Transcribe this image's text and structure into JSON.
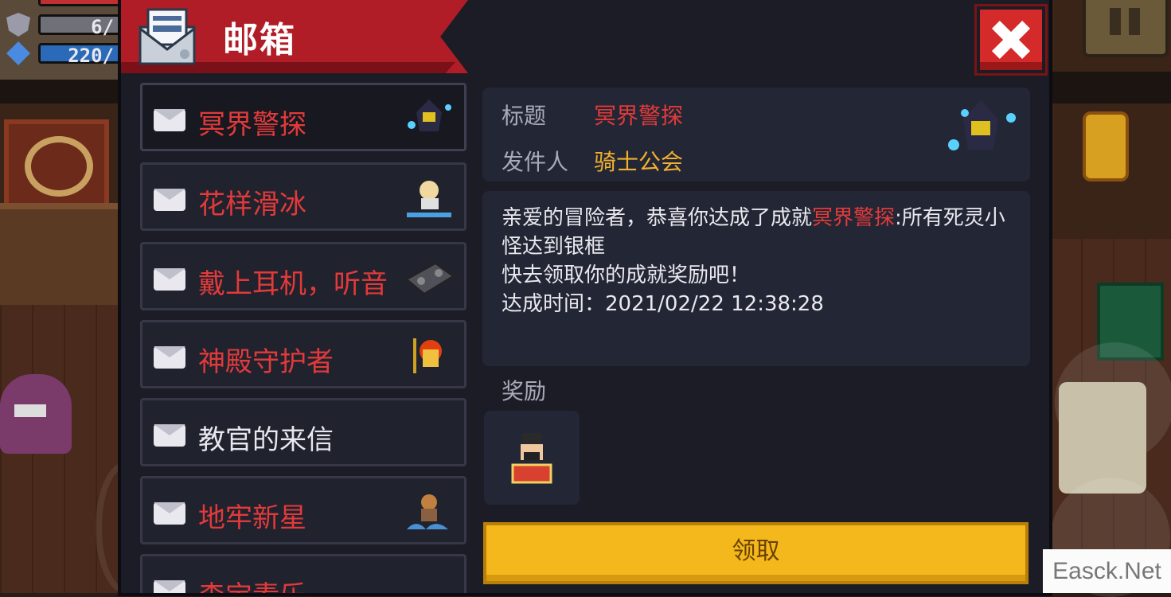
{
  "hud": {
    "armor": "6/",
    "energy": "220/"
  },
  "header": {
    "title": "邮箱"
  },
  "mail_list": [
    {
      "label": "冥界警探",
      "color": "red",
      "icon": "ghost-knight-icon",
      "selected": true
    },
    {
      "label": "花样滑冰",
      "color": "red",
      "icon": "skater-icon"
    },
    {
      "label": "戴上耳机，听音",
      "color": "red",
      "icon": "boombox-icon"
    },
    {
      "label": "神殿守护者",
      "color": "red",
      "icon": "temple-guardian-icon"
    },
    {
      "label": "教官的来信",
      "color": "white",
      "icon": ""
    },
    {
      "label": "地牢新星",
      "color": "red",
      "icon": "monkey-wave-icon"
    },
    {
      "label": "森宝素乐",
      "color": "red",
      "icon": ""
    }
  ],
  "detail": {
    "title_label": "标题",
    "title_value": "冥界警探",
    "sender_label": "发件人",
    "sender_value": "骑士公会",
    "body_prefix": "亲爱的冒险者，恭喜你达成了成就",
    "body_highlight": "冥界警探",
    "body_suffix": ":所有死灵小怪达到银框",
    "body_line2": "快去领取你的成就奖励吧！",
    "body_line3": "达成时间：2021/02/22 12:38:28",
    "reward_label": "奖励",
    "reward_item": "character-skin-icon",
    "claim_label": "领取"
  },
  "watermark": "Easck.Net",
  "colors": {
    "red_text": "#e23a3a",
    "gold_text": "#f0b030",
    "header_red": "#b11d27",
    "claim_yellow": "#f4b81c"
  }
}
